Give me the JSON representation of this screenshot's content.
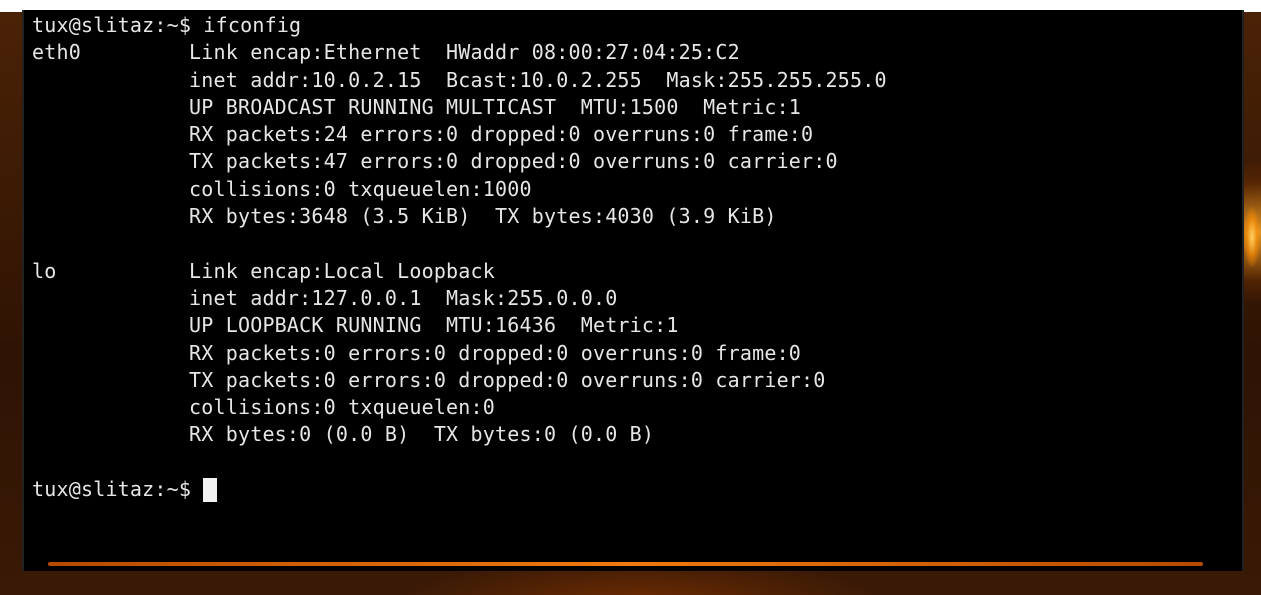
{
  "terminal": {
    "command_prompt": "tux@slitaz:~$ ifconfig",
    "eth0": {
      "name": "eth0",
      "lines": [
        "Link encap:Ethernet  HWaddr 08:00:27:04:25:C2",
        "inet addr:10.0.2.15  Bcast:10.0.2.255  Mask:255.255.255.0",
        "UP BROADCAST RUNNING MULTICAST  MTU:1500  Metric:1",
        "RX packets:24 errors:0 dropped:0 overruns:0 frame:0",
        "TX packets:47 errors:0 dropped:0 overruns:0 carrier:0",
        "collisions:0 txqueuelen:1000",
        "RX bytes:3648 (3.5 KiB)  TX bytes:4030 (3.9 KiB)"
      ]
    },
    "lo": {
      "name": "lo",
      "lines": [
        "Link encap:Local Loopback",
        "inet addr:127.0.0.1  Mask:255.0.0.0",
        "UP LOOPBACK RUNNING  MTU:16436  Metric:1",
        "RX packets:0 errors:0 dropped:0 overruns:0 frame:0",
        "TX packets:0 errors:0 dropped:0 overruns:0 carrier:0",
        "collisions:0 txqueuelen:0",
        "RX bytes:0 (0.0 B)  TX bytes:0 (0.0 B)"
      ]
    },
    "final_prompt": "tux@slitaz:~$"
  },
  "colors": {
    "terminal_bg": "#000000",
    "terminal_fg": "#e6e6e6",
    "accent_orange": "#f07a10",
    "cursor": "#f2f2f2"
  }
}
